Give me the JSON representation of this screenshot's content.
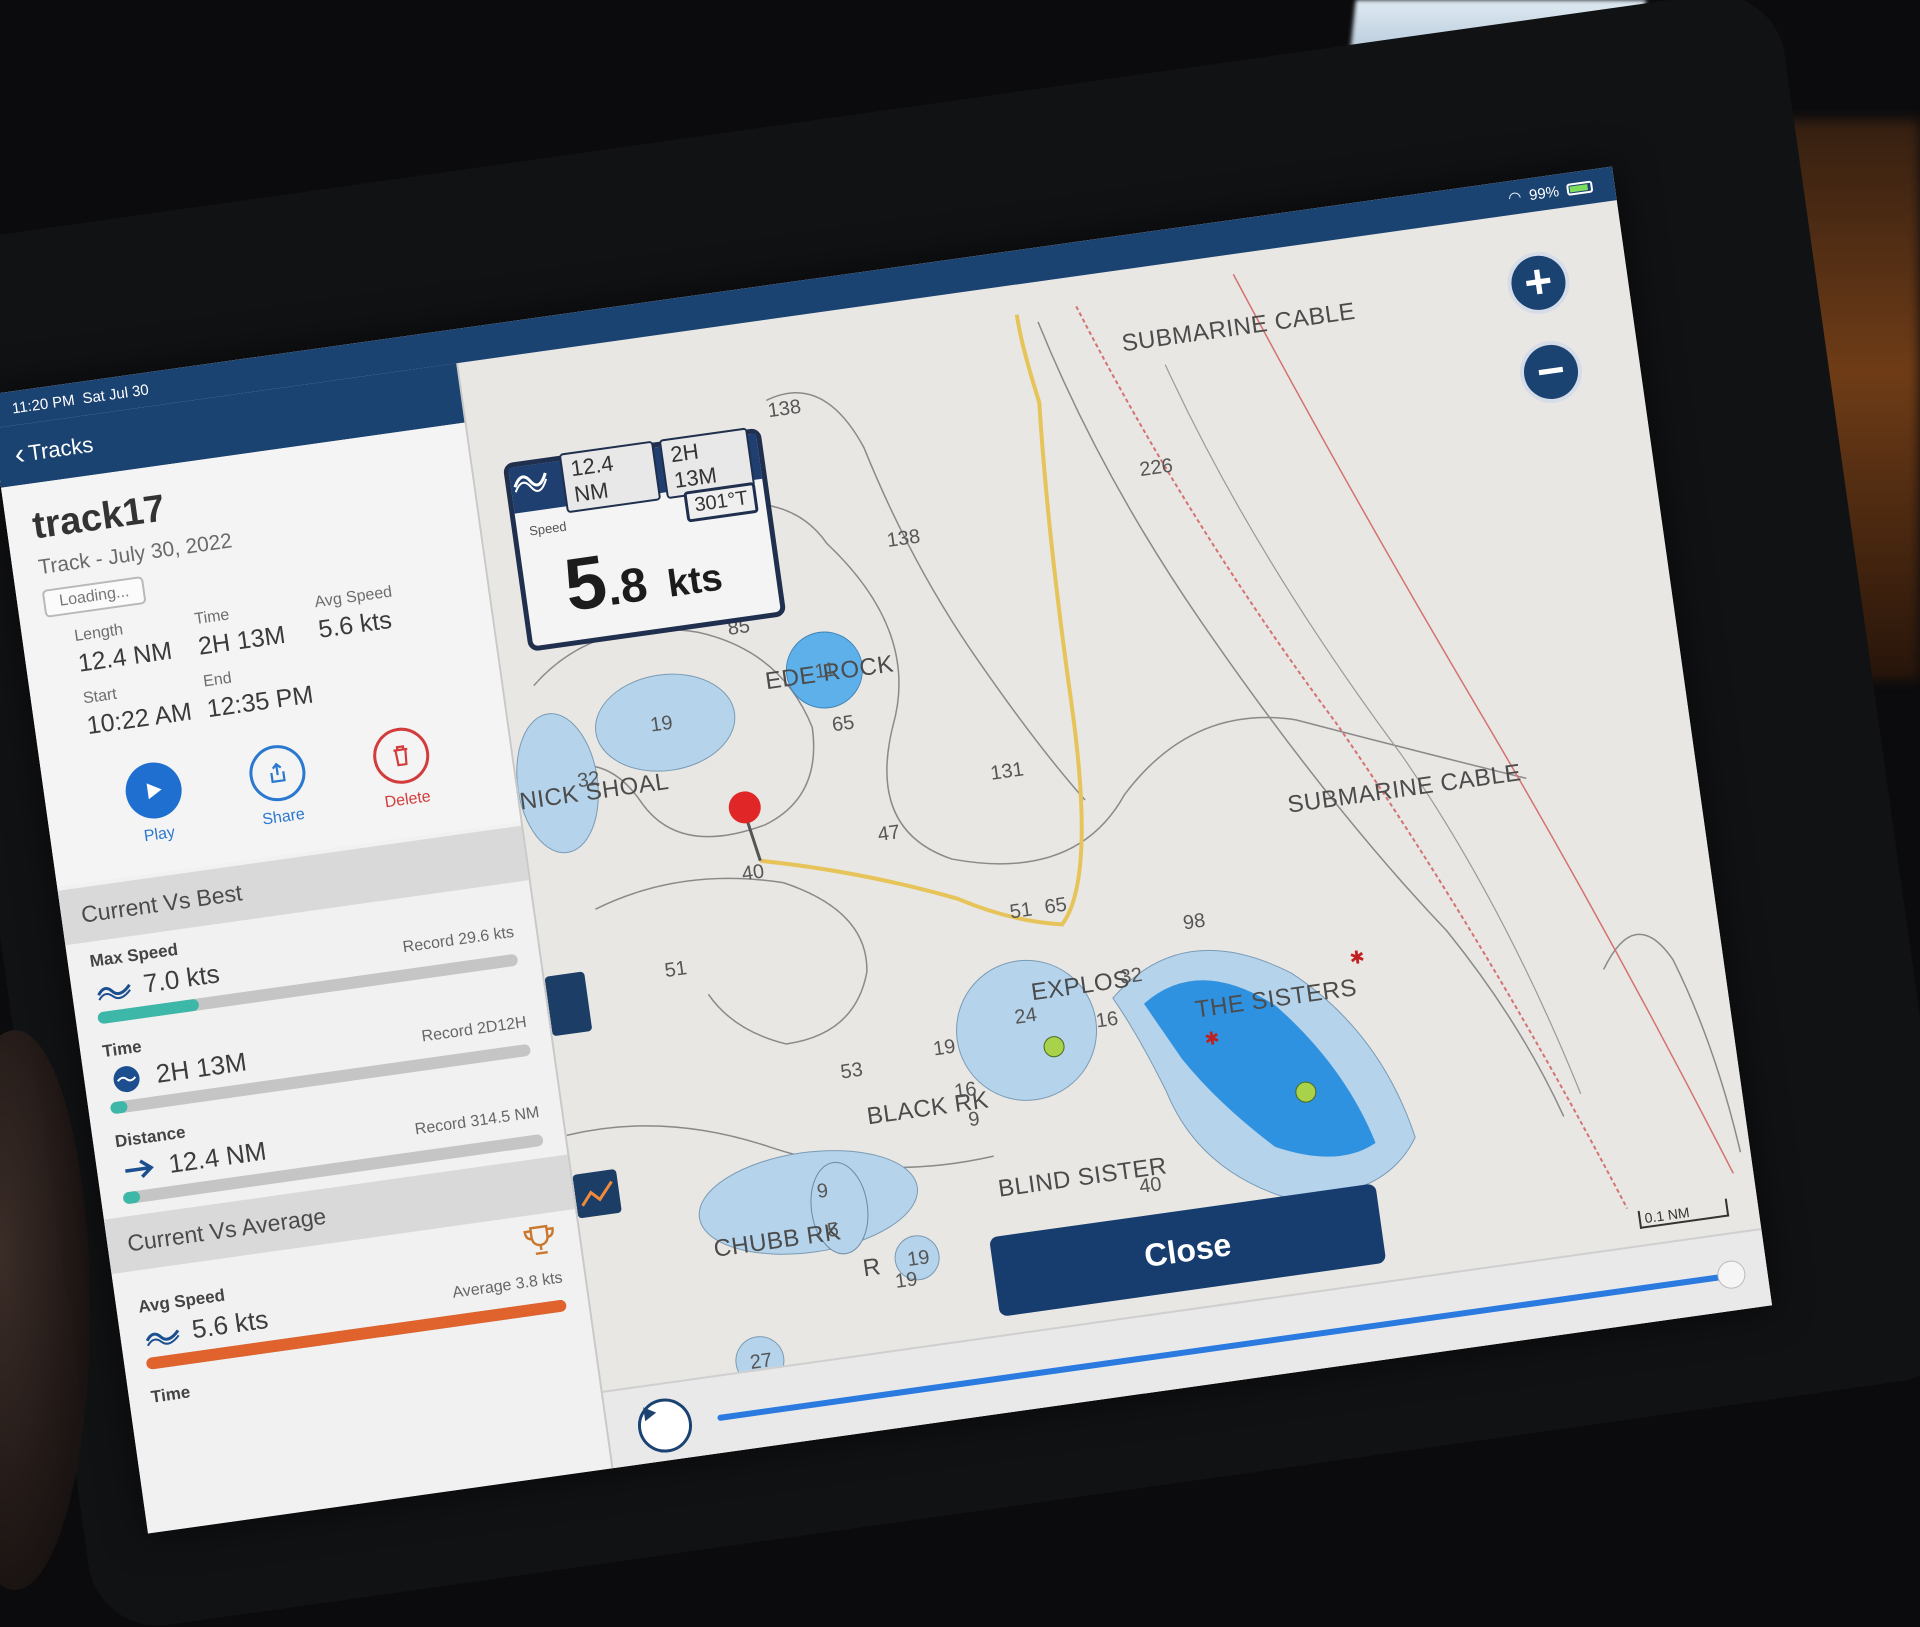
{
  "status_bar": {
    "time": "11:20 PM",
    "date": "Sat Jul 30",
    "battery": "99%"
  },
  "nav": {
    "back_label": "Tracks"
  },
  "track": {
    "name": "track17",
    "subtitle": "Track - July 30, 2022",
    "loading": "Loading..."
  },
  "stats": {
    "length_label": "Length",
    "length_value": "12.4 NM",
    "time_label": "Time",
    "time_value": "2H 13M",
    "avg_label": "Avg Speed",
    "avg_value": "5.6 kts",
    "start_label": "Start",
    "start_value": "10:22 AM",
    "end_label": "End",
    "end_value": "12:35 PM"
  },
  "actions": {
    "play": "Play",
    "share": "Share",
    "delete": "Delete"
  },
  "current_vs_best": {
    "title": "Current Vs Best",
    "rows": [
      {
        "label": "Max Speed",
        "value": "7.0 kts",
        "record": "Record  29.6 kts",
        "fill": 0.24,
        "color": "#3db8a8"
      },
      {
        "label": "Time",
        "value": "2H 13M",
        "record": "Record  2D12H",
        "fill": 0.04,
        "color": "#3db8a8"
      },
      {
        "label": "Distance",
        "value": "12.4 NM",
        "record": "Record 314.5 NM",
        "fill": 0.04,
        "color": "#3db8a8"
      }
    ]
  },
  "current_vs_average": {
    "title": "Current Vs Average",
    "rows": [
      {
        "label": "Avg Speed",
        "value": "5.6 kts",
        "record": "Average   3.8 kts",
        "fill": 1.0,
        "color": "#e0622c"
      }
    ],
    "next_label": "Time"
  },
  "dashboard": {
    "distance": "12.4 NM",
    "duration": "2H 13M",
    "heading": "301°T",
    "speed_label": "Speed",
    "speed_whole": "5",
    "speed_fraction": ".8",
    "speed_unit": "kts"
  },
  "map": {
    "labels": {
      "submarine_cable_1": "SUBMARINE CABLE",
      "submarine_cable_2": "SUBMARINE CABLE",
      "ede_rock": "EDE ROCK",
      "shoal": "NICK SHOAL",
      "explos": "EXPLOS",
      "black_rk": "BLACK RK",
      "the_sisters": "THE SISTERS",
      "chubb_rk": "CHUBB RK",
      "blind_sister": "BLIND SISTER",
      "r": "R"
    },
    "depths": [
      "138",
      "138",
      "226",
      "85",
      "19",
      "11",
      "65",
      "32",
      "131",
      "47",
      "40",
      "51",
      "51",
      "65",
      "98",
      "32",
      "53",
      "19",
      "24",
      "16",
      "16",
      "9",
      "9",
      "5",
      "19",
      "19",
      "27",
      "40"
    ],
    "scale": "0.1  NM"
  },
  "close_label": "Close",
  "zoom": {
    "in": "+",
    "out": "−"
  }
}
